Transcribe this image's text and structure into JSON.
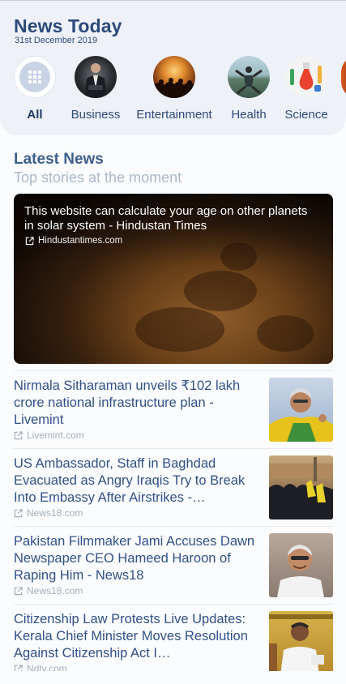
{
  "header": {
    "title": "News Today",
    "date": "31st December 2019"
  },
  "categories": [
    {
      "label": "All",
      "icon": "grid-icon"
    },
    {
      "label": "Business",
      "icon": "business-thumbnail"
    },
    {
      "label": "Entertainment",
      "icon": "entertainment-thumbnail"
    },
    {
      "label": "Health",
      "icon": "health-thumbnail"
    },
    {
      "label": "Science",
      "icon": "science-thumbnail"
    }
  ],
  "latest": {
    "title": "Latest News",
    "subtitle": "Top stories at the moment"
  },
  "featured": {
    "title": "This website can calculate your age on other planets in solar system - Hindustan Times",
    "source": "Hindustantimes.com"
  },
  "news": [
    {
      "title": "Nirmala Sitharaman unveils ₹102 lakh crore national infrastructure plan - Livemint",
      "source": "Livemint.com"
    },
    {
      "title": "US Ambassador, Staff in Baghdad Evacuated as Angry Iraqis Try to Break Into Embassy After Airstrikes -…",
      "source": "News18.com"
    },
    {
      "title": "Pakistan Filmmaker Jami Accuses Dawn Newspaper CEO Hameed Haroon of Raping Him - News18",
      "source": "News18.com"
    },
    {
      "title": "Citizenship Law Protests Live Updates: Kerala Chief Minister Moves Resolution Against Citizenship Act I…",
      "source": "Ndtv.com"
    }
  ],
  "colors": {
    "accent": "#2c4a7a",
    "muted": "#a9b8cc"
  }
}
